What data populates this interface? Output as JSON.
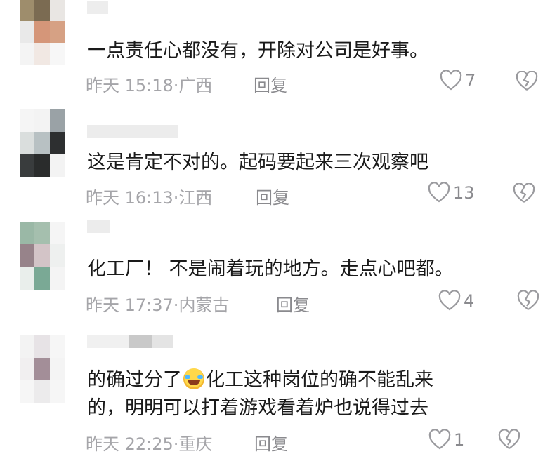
{
  "comments": [
    {
      "text_lines": [
        "一点责任心都没有，开除对公司是好事。"
      ],
      "time": "昨天 15:18",
      "location": "广西",
      "reply_label": "回复",
      "likes": "7"
    },
    {
      "text_lines": [
        "这是肯定不对的。起码要起来三次观察吧"
      ],
      "time": "昨天 16:13",
      "location": "江西",
      "reply_label": "回复",
      "likes": "13"
    },
    {
      "text_lines": [
        "化工厂！ 不是闹着玩的地方。走点心吧都。"
      ],
      "time": "昨天 17:37",
      "location": "内蒙古",
      "reply_label": "回复",
      "likes": "4"
    },
    {
      "text_lines": [
        "的确过分了",
        "化工这种岗位的确不能乱来",
        "的，明明可以打着游戏看着炉也说得过去"
      ],
      "time": "昨天 22:25",
      "location": "重庆",
      "reply_label": "回复",
      "likes": "1"
    }
  ],
  "meta_separator": "·",
  "icons": {
    "like": "heart-outline-icon",
    "dislike": "broken-heart-icon",
    "inline_emoji": "rofl-emoji-icon"
  },
  "colors": {
    "text": "#1a1a1a",
    "meta": "#a5a5a9",
    "action": "#8a8a8e"
  }
}
